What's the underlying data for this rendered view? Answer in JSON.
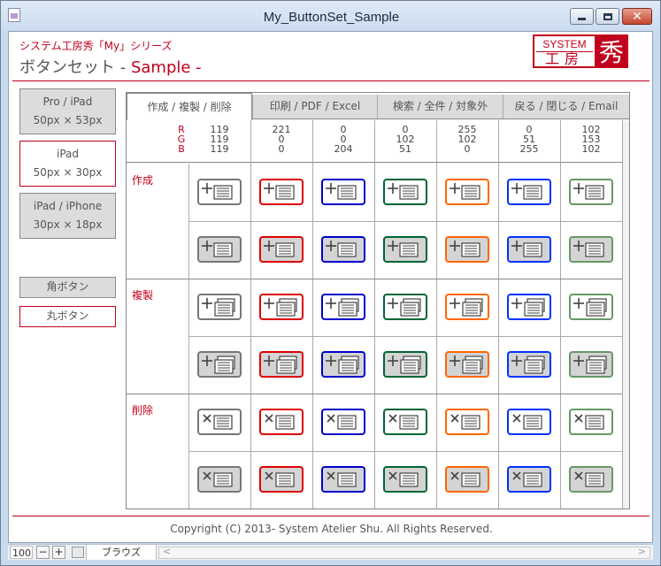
{
  "window": {
    "title": "My_ButtonSet_Sample"
  },
  "header": {
    "series": "システム工房秀「My」シリーズ",
    "heading_main": "ボタンセット - ",
    "heading_accent": "Sample -",
    "logo_system": "SYSTEM",
    "logo_kobo": "工房",
    "logo_shu": "秀"
  },
  "sidebar": {
    "size_buttons": [
      {
        "line1": "Pro / iPad",
        "line2": "50px × 53px",
        "style": "gray"
      },
      {
        "line1": "iPad",
        "line2": "50px × 30px",
        "style": "red"
      },
      {
        "line1": "iPad / iPhone",
        "line2": "30px × 18px",
        "style": "gray"
      }
    ],
    "shape_buttons": [
      {
        "label": "角ボタン",
        "style": "gray"
      },
      {
        "label": "丸ボタン",
        "style": "red"
      }
    ]
  },
  "tabs": [
    "作成 / 複製 / 削除",
    "印刷 / PDF / Excel",
    "検索 / 全件 / 対象外",
    "戻る / 閉じる / Email"
  ],
  "rgb_labels": [
    "R",
    "G",
    "B"
  ],
  "colors": [
    {
      "r": "119",
      "g": "119",
      "b": "119",
      "hex": "#777777"
    },
    {
      "r": "221",
      "g": "0",
      "b": "0",
      "hex": "#dd0000"
    },
    {
      "r": "0",
      "g": "0",
      "b": "204",
      "hex": "#0000cc"
    },
    {
      "r": "0",
      "g": "102",
      "b": "51",
      "hex": "#006633"
    },
    {
      "r": "255",
      "g": "102",
      "b": "0",
      "hex": "#ff6600"
    },
    {
      "r": "0",
      "g": "51",
      "b": "255",
      "hex": "#0033ff"
    },
    {
      "r": "102",
      "g": "153",
      "b": "102",
      "hex": "#669966"
    }
  ],
  "groups": [
    {
      "label": "作成",
      "icon": "create-icon"
    },
    {
      "label": "複製",
      "icon": "duplicate-icon"
    },
    {
      "label": "削除",
      "icon": "delete-icon"
    }
  ],
  "footer": {
    "copyright": "Copyright (C) 2013- System Atelier Shu. All Rights Reserved."
  },
  "statusbar": {
    "zoom": "100",
    "view": "ブラウズ"
  }
}
